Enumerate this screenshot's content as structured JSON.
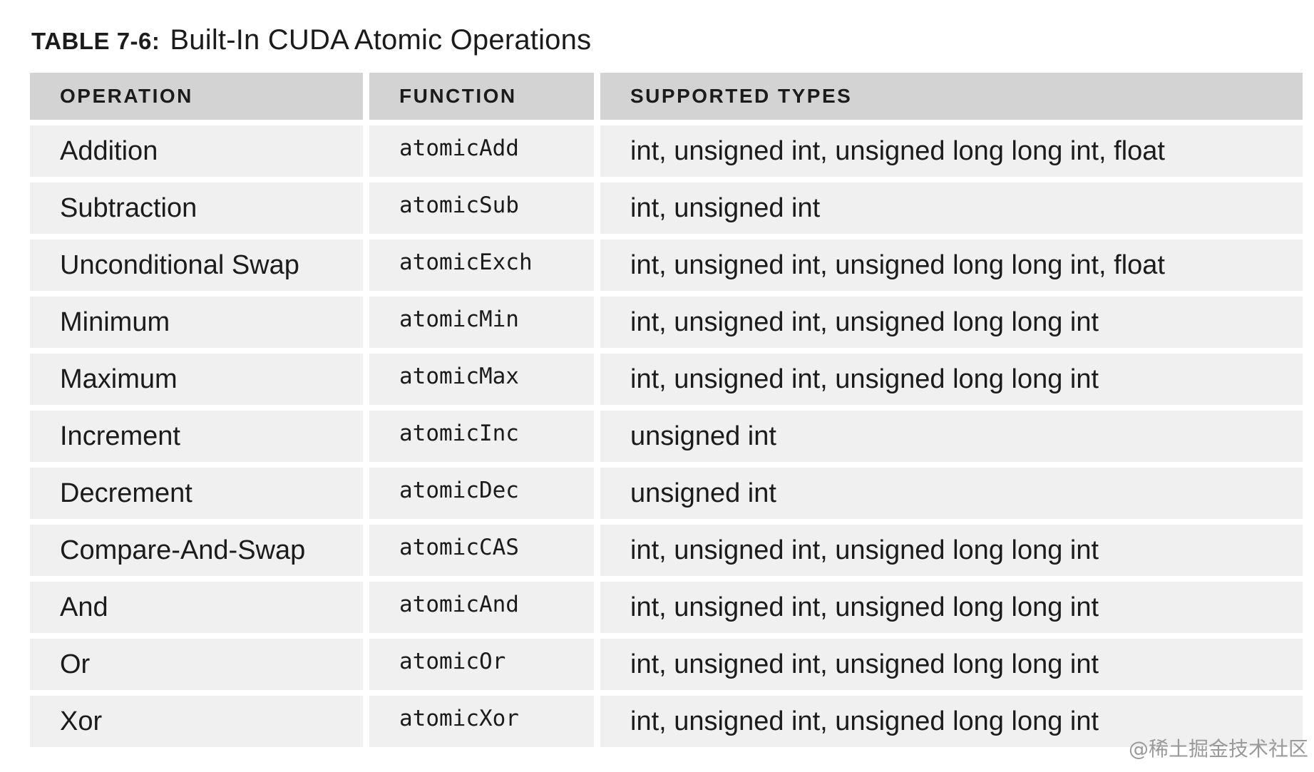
{
  "caption": {
    "label": "TABLE 7-6:",
    "title": "Built-In CUDA Atomic Operations"
  },
  "headers": [
    "OPERATION",
    "FUNCTION",
    "SUPPORTED TYPES"
  ],
  "rows": [
    {
      "operation": "Addition",
      "function": "atomicAdd",
      "types": "int, unsigned int, unsigned long long int, float"
    },
    {
      "operation": "Subtraction",
      "function": "atomicSub",
      "types": "int, unsigned int"
    },
    {
      "operation": "Unconditional Swap",
      "function": "atomicExch",
      "types": "int, unsigned int, unsigned long long int, float"
    },
    {
      "operation": "Minimum",
      "function": "atomicMin",
      "types": "int, unsigned int, unsigned long long int"
    },
    {
      "operation": "Maximum",
      "function": "atomicMax",
      "types": "int, unsigned int, unsigned long long int"
    },
    {
      "operation": "Increment",
      "function": "atomicInc",
      "types": "unsigned int"
    },
    {
      "operation": "Decrement",
      "function": "atomicDec",
      "types": "unsigned int"
    },
    {
      "operation": "Compare-And-Swap",
      "function": "atomicCAS",
      "types": "int, unsigned int, unsigned long long int"
    },
    {
      "operation": "And",
      "function": "atomicAnd",
      "types": "int, unsigned int, unsigned long long int"
    },
    {
      "operation": "Or",
      "function": "atomicOr",
      "types": "int, unsigned int, unsigned long long int"
    },
    {
      "operation": "Xor",
      "function": "atomicXor",
      "types": "int, unsigned int, unsigned long long int"
    }
  ],
  "watermark": "@稀土掘金技术社区",
  "colors": {
    "header_bg": "#d3d3d3",
    "row_bg": "#f0f0f0",
    "text": "#1b1b1b"
  }
}
